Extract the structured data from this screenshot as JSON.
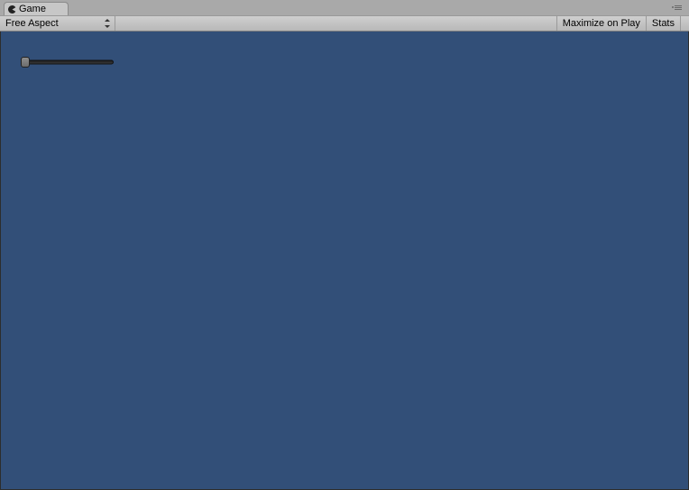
{
  "tab": {
    "label": "Game"
  },
  "toolbar": {
    "aspect_label": "Free Aspect",
    "maximize_label": "Maximize on Play",
    "stats_label": "Stats"
  },
  "viewport": {
    "background_color": "#324f78"
  },
  "slider": {
    "value": 0,
    "min": 0,
    "max": 1
  }
}
